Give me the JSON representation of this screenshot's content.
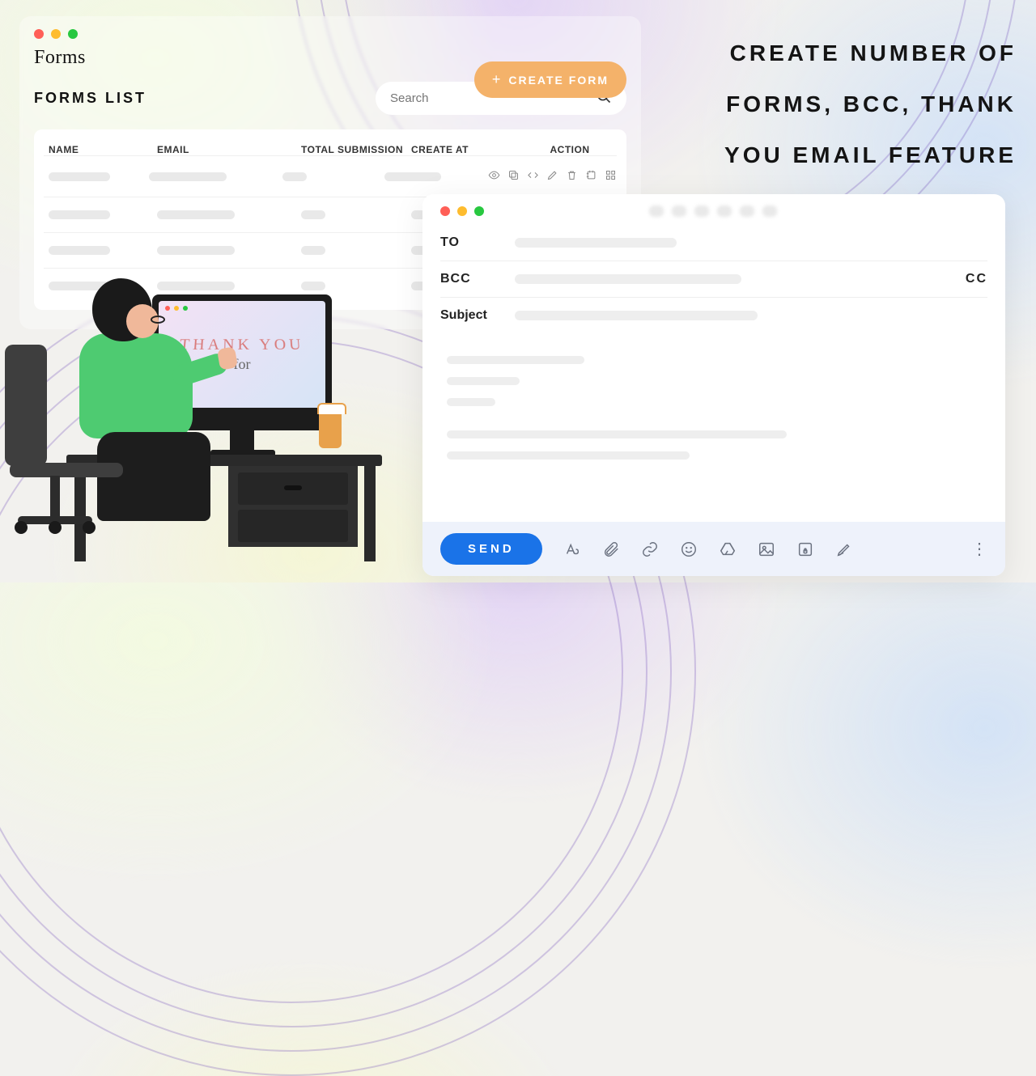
{
  "headline": "CREATE NUMBER OF FORMS, BCC, THANK YOU EMAIL FEATURE",
  "forms_panel": {
    "title": "Forms",
    "subhead": "FORMS LIST",
    "create_button": "CREATE FORM",
    "search_placeholder": "Search",
    "columns": {
      "name": "NAME",
      "email": "EMAIL",
      "submission": "TOTAL SUBMISSION",
      "created": "CREATE AT",
      "action": "ACTION"
    }
  },
  "thank_you_screen": {
    "line1": "THANK YOU",
    "line2": "for"
  },
  "email_panel": {
    "to_label": "TO",
    "bcc_label": "BCC",
    "cc_label": "CC",
    "subject_label": "Subject",
    "send_label": "SEND"
  }
}
